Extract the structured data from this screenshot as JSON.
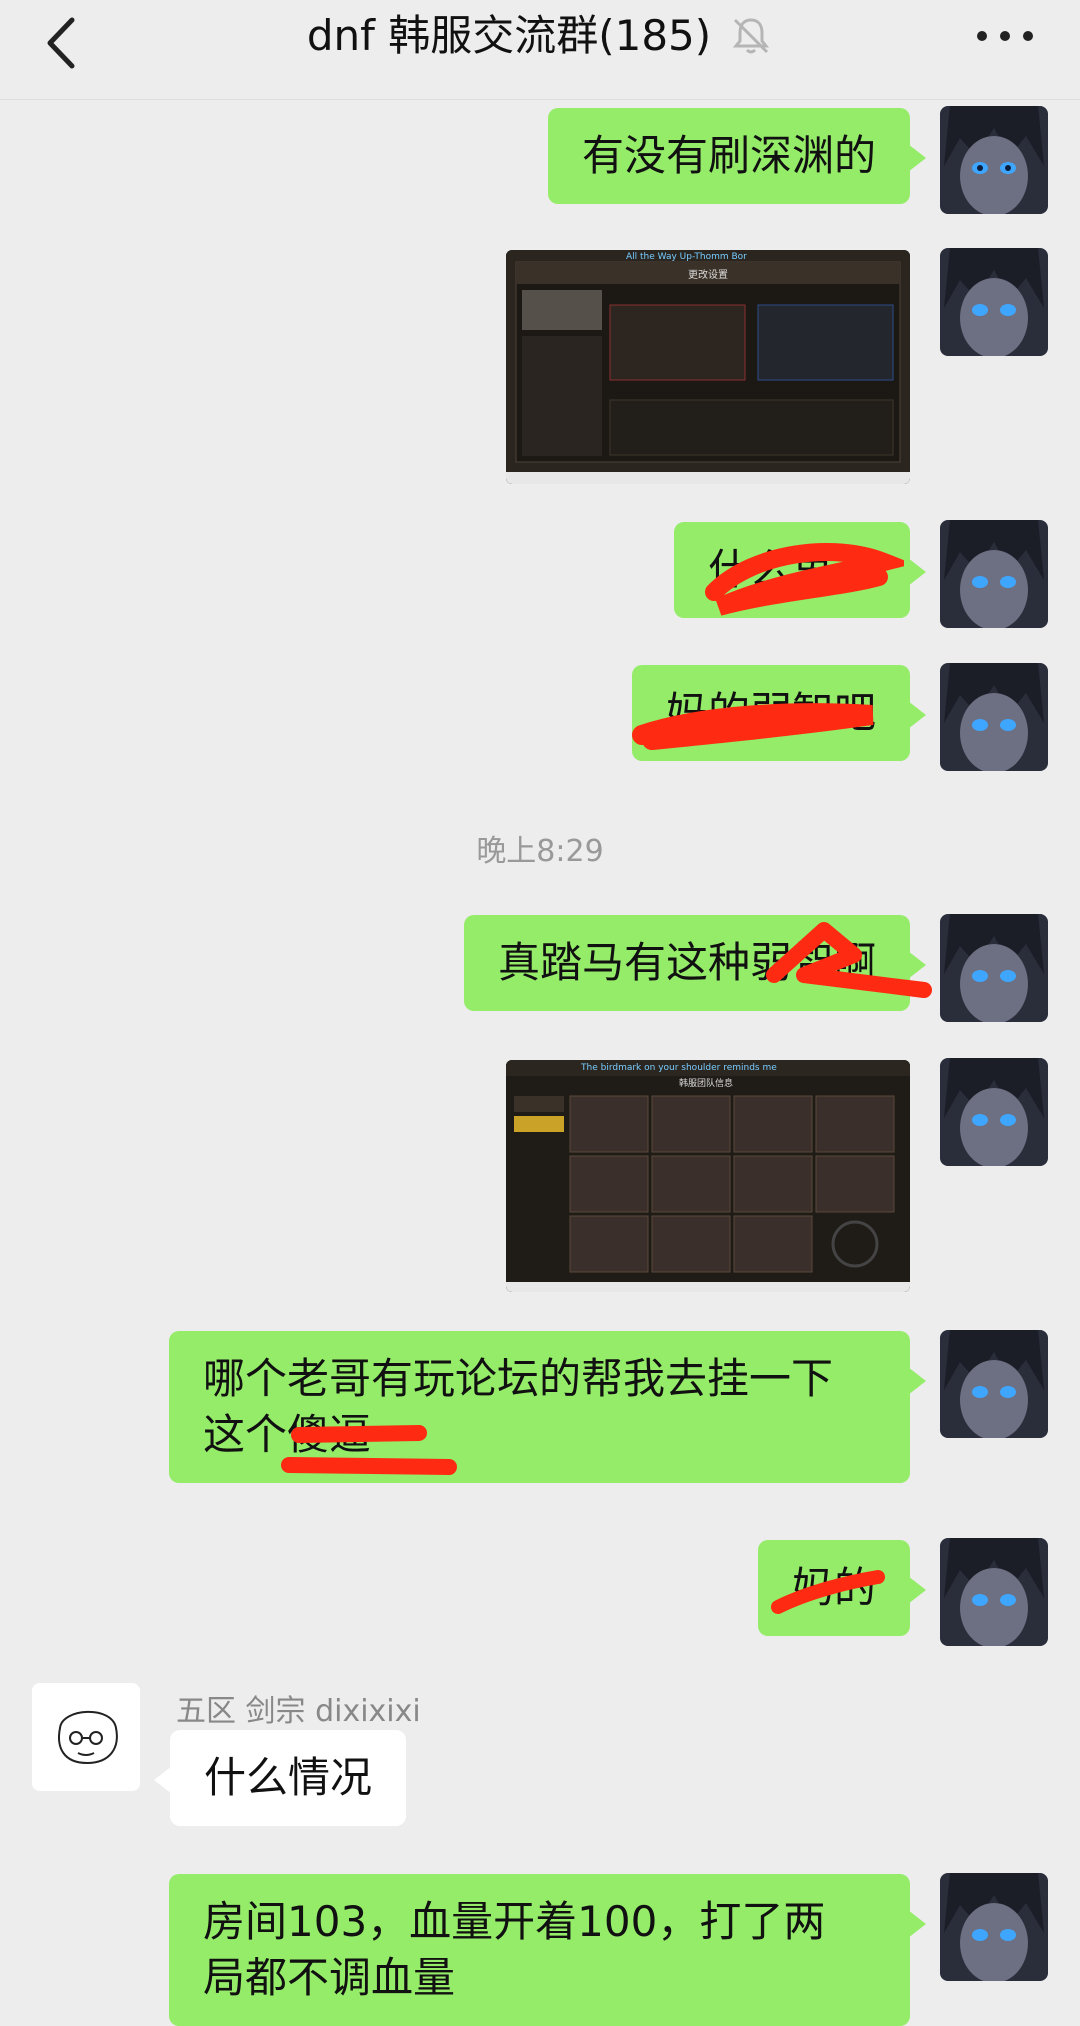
{
  "header": {
    "title": "dnf 韩服交流群(185)",
    "back_icon": "chevron-left-icon",
    "mute_icon": "bell-off-icon",
    "more_icon": "more-dots-icon"
  },
  "messages": [
    {
      "type": "text",
      "from": "me",
      "text": "有没有刷深渊的"
    },
    {
      "type": "image",
      "from": "me",
      "caption_text": "All the Way Up-Thomm Bor",
      "title_text": "更改设置"
    },
    {
      "type": "text",
      "from": "me",
      "text": "什么鬼道",
      "redacted": true
    },
    {
      "type": "text",
      "from": "me",
      "text": "妈的弱智吧",
      "redacted": true
    },
    {
      "type": "timestamp",
      "text": "晚上8:29"
    },
    {
      "type": "text",
      "from": "me",
      "text": "真踏马有这种弱智啊"
    },
    {
      "type": "image",
      "from": "me",
      "caption_text": "The birdmark on your shoulder reminds me",
      "title_text": "韩服团队信息"
    },
    {
      "type": "text",
      "from": "me",
      "line1": "哪个老哥有玩论坛的帮我去挂一下",
      "line2": "这个傻逼"
    },
    {
      "type": "text",
      "from": "me",
      "text": "妈的"
    },
    {
      "type": "text",
      "from": "other",
      "sender": "五区 剑宗 dixixixi",
      "text": "什么情况"
    },
    {
      "type": "text",
      "from": "me",
      "line1": "房间103，血量开着100，打了两",
      "line2": "局都不调血量"
    }
  ],
  "colors": {
    "me_bubble": "#95ec69",
    "other_bubble": "#ffffff",
    "background": "#ededed",
    "scribble": "#ff2a12"
  }
}
